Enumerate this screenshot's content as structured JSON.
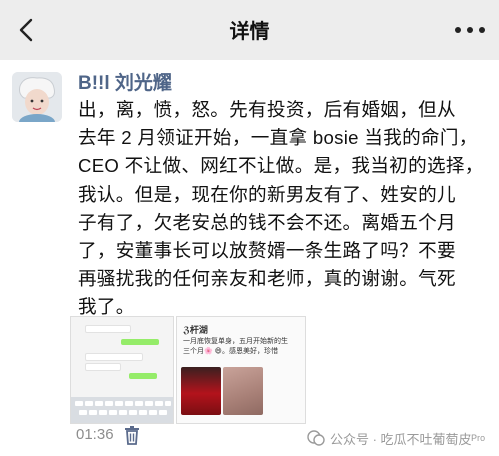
{
  "header": {
    "title": "详情"
  },
  "post": {
    "author": "B!!l 刘光耀",
    "lines": [
      "出，离，愤，怒。先有投资，后有婚姻，但从",
      "去年 2 月领证开始，一直拿 bosie 当我的命门，",
      "CEO 不让做、网红不让做。是，我当初的选择，",
      "我认。但是，现在你的新男友有了、姓安的儿",
      "子有了，欠老安总的钱不会不还。离婚五个月",
      "了，安董事长可以放赘婿一条生路了吗？不要",
      "再骚扰我的任何亲友和老师，真的谢谢。气死",
      "我了。"
    ],
    "time": "01:36"
  },
  "attachment": {
    "screenshot2": {
      "title": "ℨ杆湖",
      "lines": [
        "一月底恢复单身，五月开始新的生",
        "三个月🌸 😄。感恩美好，珍惜"
      ]
    }
  },
  "watermark": {
    "text": "公众号 · 吃瓜不吐葡萄皮ᴾʳᵒ"
  },
  "colors": {
    "name": "#4f6588",
    "topbar": "#ededed",
    "meta": "#8d8d8d"
  }
}
